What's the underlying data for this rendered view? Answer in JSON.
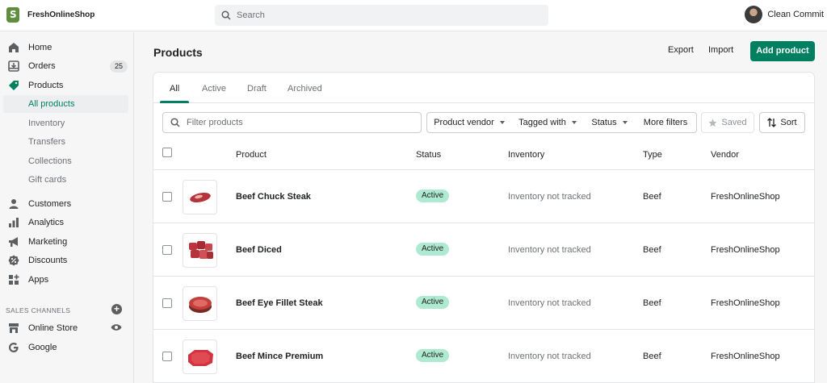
{
  "topbar": {
    "store_name": "FreshOnlineShop",
    "search_placeholder": "Search",
    "user_name": "Clean Commit"
  },
  "sidebar": {
    "items": [
      {
        "label": "Home",
        "icon": "home-icon"
      },
      {
        "label": "Orders",
        "icon": "orders-icon",
        "badge": "25"
      },
      {
        "label": "Products",
        "icon": "tag-icon"
      },
      {
        "label": "All products"
      },
      {
        "label": "Inventory"
      },
      {
        "label": "Transfers"
      },
      {
        "label": "Collections"
      },
      {
        "label": "Gift cards"
      },
      {
        "label": "Customers",
        "icon": "person-icon"
      },
      {
        "label": "Analytics",
        "icon": "bar-chart-icon"
      },
      {
        "label": "Marketing",
        "icon": "megaphone-icon"
      },
      {
        "label": "Discounts",
        "icon": "discount-icon"
      },
      {
        "label": "Apps",
        "icon": "apps-icon"
      }
    ],
    "sales_channels_title": "SALES CHANNELS",
    "channels": [
      {
        "label": "Online Store",
        "icon": "store-icon"
      },
      {
        "label": "Google",
        "icon": "google-icon"
      }
    ]
  },
  "page": {
    "title": "Products",
    "export_label": "Export",
    "import_label": "Import",
    "add_product_label": "Add product"
  },
  "tabs": [
    "All",
    "Active",
    "Draft",
    "Archived"
  ],
  "filters": {
    "placeholder": "Filter products",
    "product_vendor": "Product vendor",
    "tagged_with": "Tagged with",
    "status": "Status",
    "more_filters": "More filters",
    "saved": "Saved",
    "sort": "Sort"
  },
  "table": {
    "columns": [
      "Product",
      "Status",
      "Inventory",
      "Type",
      "Vendor"
    ],
    "rows": [
      {
        "name": "Beef Chuck Steak",
        "status": "Active",
        "inventory": "Inventory not tracked",
        "type": "Beef",
        "vendor": "FreshOnlineShop"
      },
      {
        "name": "Beef Diced",
        "status": "Active",
        "inventory": "Inventory not tracked",
        "type": "Beef",
        "vendor": "FreshOnlineShop"
      },
      {
        "name": "Beef Eye Fillet Steak",
        "status": "Active",
        "inventory": "Inventory not tracked",
        "type": "Beef",
        "vendor": "FreshOnlineShop"
      },
      {
        "name": "Beef Mince Premium",
        "status": "Active",
        "inventory": "Inventory not tracked",
        "type": "Beef",
        "vendor": "FreshOnlineShop"
      }
    ]
  },
  "colors": {
    "accent": "#008060",
    "status_active_bg": "#aee9d1"
  }
}
